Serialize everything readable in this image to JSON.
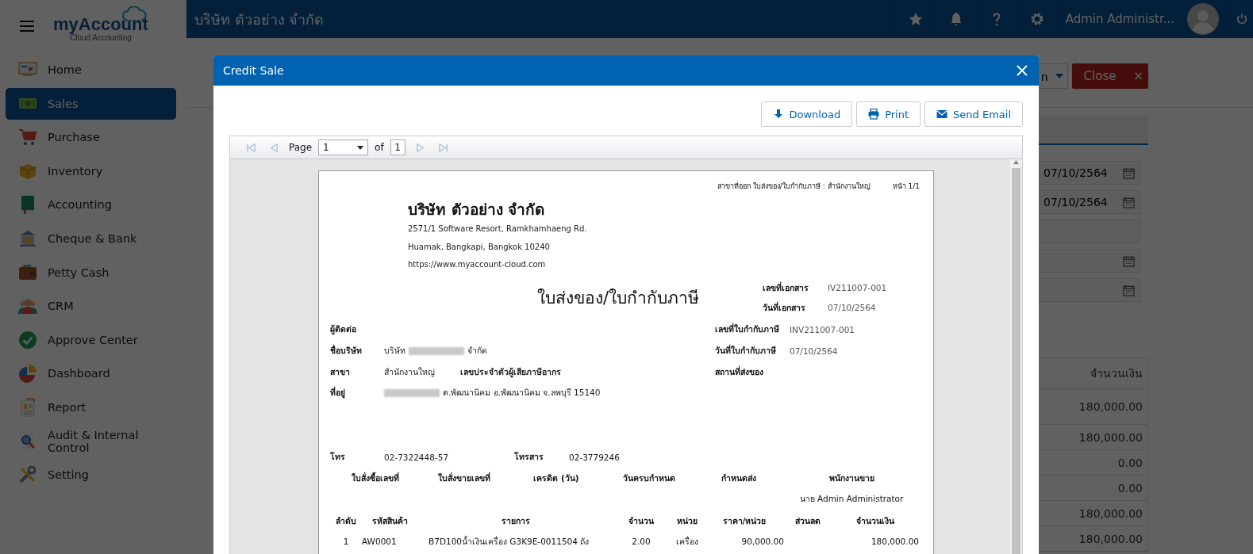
{
  "sidebar": {
    "logo": {
      "name": "myAccount",
      "tagline": "Cloud Accounting"
    },
    "items": [
      {
        "label": "Home",
        "selected": false
      },
      {
        "label": "Sales",
        "selected": true
      },
      {
        "label": "Purchase",
        "selected": false
      },
      {
        "label": "Inventory",
        "selected": false
      },
      {
        "label": "Accounting",
        "selected": false
      },
      {
        "label": "Cheque & Bank",
        "selected": false
      },
      {
        "label": "Petty Cash",
        "selected": false
      },
      {
        "label": "CRM",
        "selected": false
      },
      {
        "label": "Approve Center",
        "selected": false
      },
      {
        "label": "Dashboard",
        "selected": false
      },
      {
        "label": "Report",
        "selected": false
      },
      {
        "label": "Audit & Internal Control",
        "selected": false
      },
      {
        "label": "Setting",
        "selected": false
      }
    ]
  },
  "topbar": {
    "company": "บริษัท ตัวอย่าง จำกัด",
    "user": "Admin Administr..."
  },
  "page": {
    "toolbar": {
      "dropdown_label": "n",
      "close_label": "Close",
      "close_icon": "×"
    },
    "fields": [
      {
        "kind": "date",
        "value": "07/10/2564"
      },
      {
        "kind": "date",
        "value": "07/10/2564"
      },
      {
        "kind": "text"
      },
      {
        "kind": "date"
      },
      {
        "kind": "date"
      }
    ],
    "table": {
      "column_header": "จำนวนเงิน",
      "rows": [
        "180,000.00",
        "180,000.00",
        "0.00",
        "0.00",
        "180,000.00",
        "180,000.00"
      ]
    }
  },
  "modal": {
    "title": "Credit Sale",
    "buttons": [
      "Download",
      "Print",
      "Send Email"
    ],
    "viewer": {
      "page_label": "Page",
      "page": "1",
      "of_label": "of",
      "total_pages": "1"
    },
    "document": {
      "branch_line": "สาขาที่ออก ใบส่งของ/ใบกำกับภาษี : สำนักงานใหญ่",
      "page_no": "หน้า 1/1",
      "company": {
        "name": "บริษัท ตัวอย่าง จำกัด",
        "lines": [
          "2571/1 Software Resort, Ramkhamhaeng Rd.",
          "Huamak, Bangkapi, Bangkok 10240",
          "https://www.myaccount-cloud.com"
        ]
      },
      "title": "ใบส่งของ/ใบกำกับภาษี",
      "doc_fields": [
        {
          "label": "เลขที่เอกสาร",
          "value": "IV211007-001"
        },
        {
          "label": "วันที่เอกสาร",
          "value": "07/10/2564"
        }
      ],
      "customer_fields": [
        {
          "label": "ผู้ติดต่อ"
        },
        {
          "label": "ชื่อบริษัท",
          "parts": [
            {
              "kind": "text",
              "text": "บริษัท"
            },
            {
              "kind": "redacted"
            },
            {
              "kind": "text",
              "text": "จำกัด"
            }
          ]
        },
        {
          "label": "สาขา",
          "parts": [
            {
              "kind": "text",
              "text": "สำนักงานใหญ่"
            },
            {
              "kind": "label",
              "text": "เลขประจำตัวผู้เสียภาษีอากร"
            }
          ]
        },
        {
          "label": "ที่อยู่",
          "parts": [
            {
              "kind": "redacted"
            },
            {
              "kind": "text",
              "text": "ต.พัฒนานิคม อ.พัฒนานิคม จ.ลพบุรี 15140"
            }
          ]
        }
      ],
      "tax_fields": [
        {
          "label": "เลขที่ใบกำกับภาษี",
          "value": "INV211007-001"
        },
        {
          "label": "วันที่ใบกำกับภาษี",
          "value": "07/10/2564"
        },
        {
          "label": "สถานที่ส่งของ"
        }
      ],
      "contact": {
        "phone_label": "โทร",
        "phone": "02-7322448-57",
        "fax_label": "โทรสาร",
        "fax": "02-3779246"
      },
      "order_columns": [
        "ใบสั่งซื้อเลขที่",
        "ใบสั่งขายเลขที่",
        "เครดิต (วัน)",
        "วันครบกำหนด",
        "กำหนดส่ง",
        "พนักงานขาย"
      ],
      "salesperson": "นาย Admin Administrator",
      "item_columns": [
        "ลำดับ",
        "รหัสสินค้า",
        "รายการ",
        "จำนวน",
        "หน่วย",
        "ราคา/หน่วย",
        "ส่วนลด",
        "จำนวนเงิน"
      ],
      "item_rows": [
        {
          "no": "1",
          "code": "AW0001",
          "description": "B7D100น้ำเงินเครื่อง G3K9E-0011504 ถัง",
          "quantity": "2.00",
          "unit": "เครื่อง",
          "unit_price": "90,000.00",
          "amount": "180,000.00"
        }
      ]
    }
  }
}
